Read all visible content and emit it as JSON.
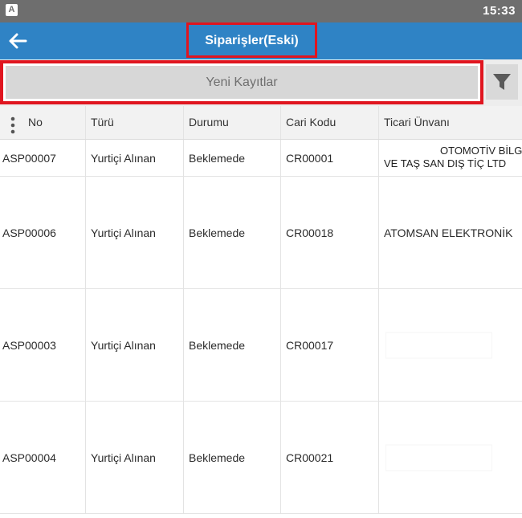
{
  "status_bar": {
    "app_icon_letter": "A",
    "time": "15:33"
  },
  "app_bar": {
    "title": "Siparişler(Eski)",
    "back_icon": "arrow-left-icon"
  },
  "filter_row": {
    "new_records_label": "Yeni Kayıtlar",
    "filter_icon": "funnel-icon"
  },
  "table": {
    "columns": [
      "No",
      "Türü",
      "Durumu",
      "Cari Kodu",
      "Ticari Ünvanı"
    ],
    "rows": [
      {
        "no": "ASP00007",
        "type": "Yurtiçi Alınan",
        "status": "Beklemede",
        "code": "CR00001",
        "title_line1": "OTOMOTİV BİLG",
        "title_line2": "VE TAŞ SAN DIŞ TİÇ LTD"
      },
      {
        "no": "ASP00006",
        "type": "Yurtiçi Alınan",
        "status": "Beklemede",
        "code": "CR00018",
        "title": "ATOMSAN ELEKTRONİK"
      },
      {
        "no": "ASP00003",
        "type": "Yurtiçi Alınan",
        "status": "Beklemede",
        "code": "CR00017",
        "title": ""
      },
      {
        "no": "ASP00004",
        "type": "Yurtiçi Alınan",
        "status": "Beklemede",
        "code": "CR00021",
        "title": ""
      }
    ]
  },
  "colors": {
    "app_bar": "#2f83c5",
    "status_bar": "#6e6e6e",
    "highlight": "#e0151f",
    "new_records_bg": "#d7d7d7"
  }
}
